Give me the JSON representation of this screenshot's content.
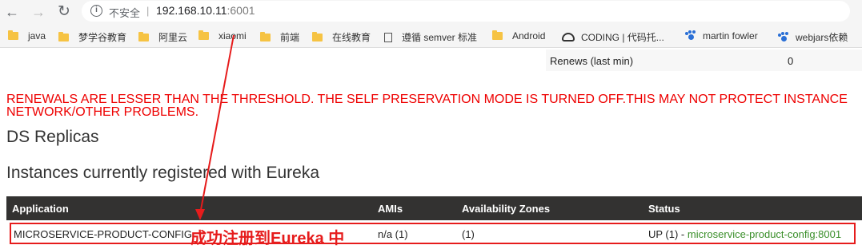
{
  "browser": {
    "insecure_label": "不安全",
    "separator": "|",
    "url_host": "192.168.10.11",
    "url_port": ":6001"
  },
  "bookmarks": [
    {
      "label": "java",
      "icon": "folder-icon"
    },
    {
      "label": "梦学谷教育",
      "icon": "folder-icon"
    },
    {
      "label": "阿里云",
      "icon": "folder-icon"
    },
    {
      "label": "xiaomi",
      "icon": "folder-icon"
    },
    {
      "label": "前端",
      "icon": "folder-icon"
    },
    {
      "label": "在线教育",
      "icon": "folder-icon"
    },
    {
      "label": "遵循 semver 标准",
      "icon": "document-icon"
    },
    {
      "label": "Android",
      "icon": "folder-icon"
    },
    {
      "label": "CODING | 代码托...",
      "icon": "coding-icon"
    },
    {
      "label": "martin fowler",
      "icon": "paw-icon"
    },
    {
      "label": "webjars依赖",
      "icon": "paw-icon"
    }
  ],
  "stats": {
    "renews_label": "Renews (last min)",
    "renews_value": "0"
  },
  "warning": {
    "line1": "RENEWALS ARE LESSER THAN THE THRESHOLD. THE SELF PRESERVATION MODE IS TURNED OFF.THIS MAY NOT PROTECT INSTANCE",
    "line2": "NETWORK/OTHER PROBLEMS."
  },
  "headings": {
    "replicas": "DS Replicas",
    "instances": "Instances currently registered with Eureka"
  },
  "table": {
    "columns": [
      "Application",
      "AMIs",
      "Availability Zones",
      "Status"
    ],
    "rows": [
      {
        "application": "MICROSERVICE-PRODUCT-CONFIG",
        "amis": "n/a (1)",
        "zones": "(1)",
        "status_prefix": "UP (1) - ",
        "status_link": "microservice-product-config:8001"
      }
    ]
  },
  "annotation": {
    "label": "成功注册到Eureka 中",
    "color": "#e61c1c"
  }
}
